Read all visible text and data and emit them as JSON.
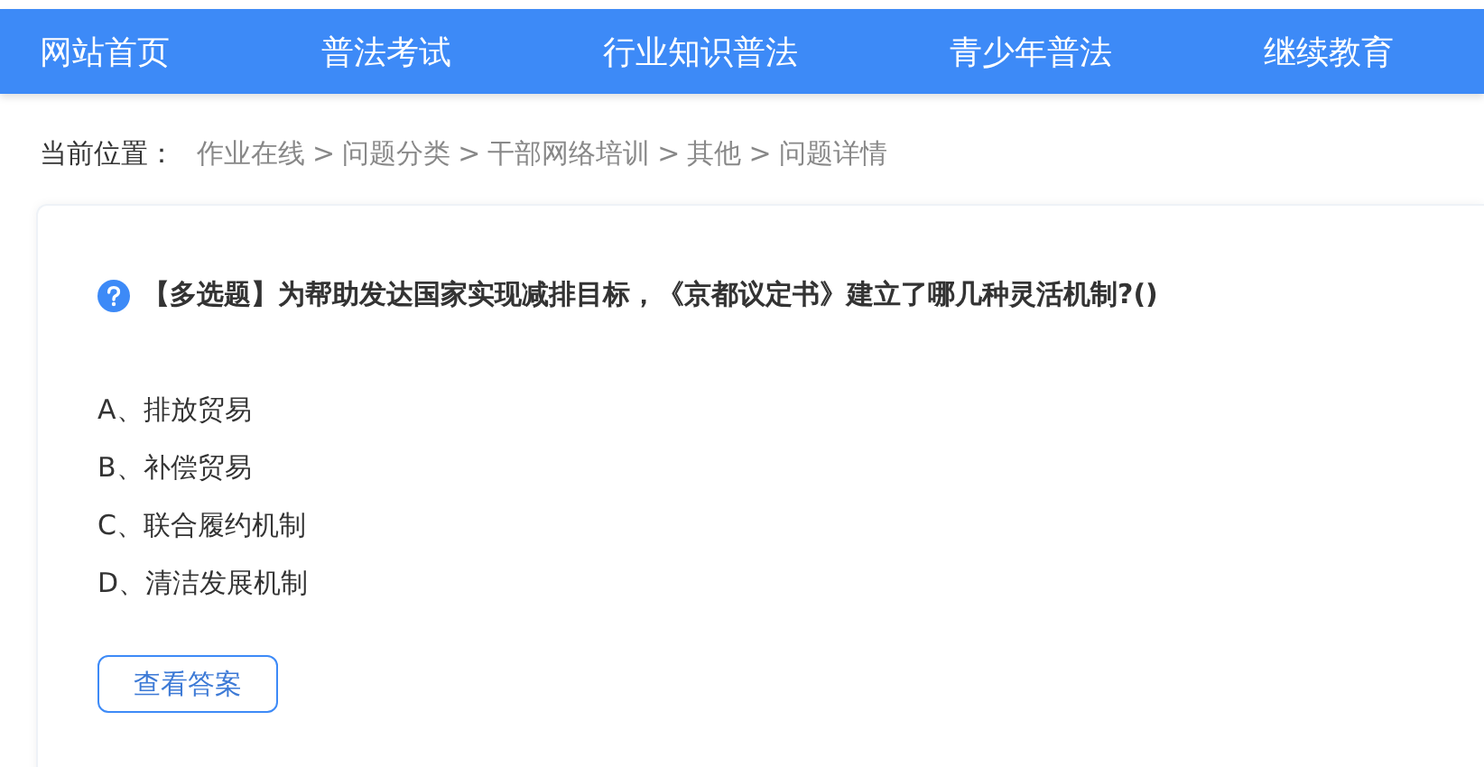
{
  "nav": {
    "items": [
      {
        "label": "网站首页"
      },
      {
        "label": "普法考试"
      },
      {
        "label": "行业知识普法"
      },
      {
        "label": "青少年普法"
      },
      {
        "label": "继续教育"
      }
    ]
  },
  "breadcrumb": {
    "label": "当前位置：",
    "separator": ">",
    "items": [
      "作业在线",
      "问题分类",
      "干部网络培训",
      "其他",
      "问题详情"
    ]
  },
  "question": {
    "type_tag": "【多选题】",
    "text": "为帮助发达国家实现减排目标，《京都议定书》建立了哪几种灵活机制?()",
    "options": [
      "A、排放贸易",
      "B、补偿贸易",
      "C、联合履约机制",
      "D、清洁发展机制"
    ],
    "button": "查看答案"
  }
}
